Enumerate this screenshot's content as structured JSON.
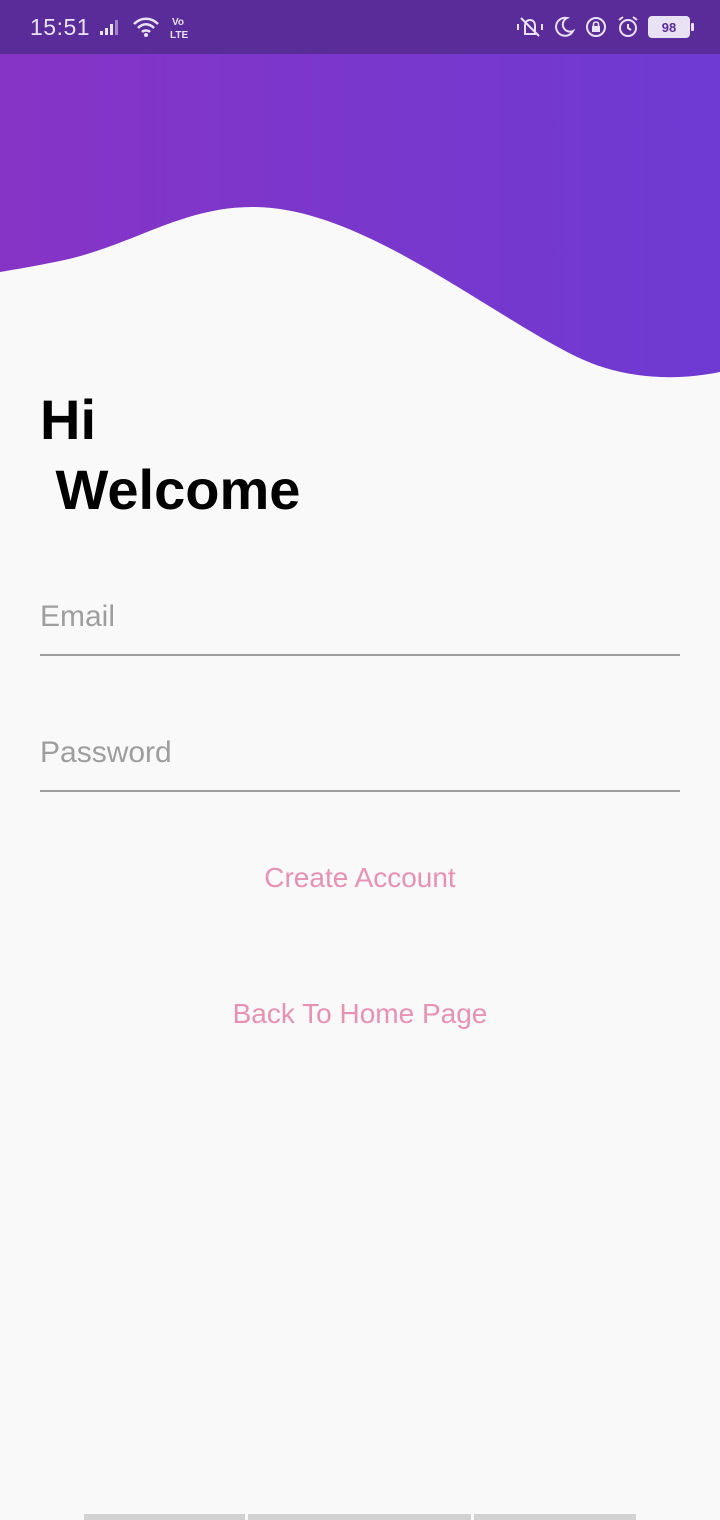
{
  "status_bar": {
    "time": "15:51",
    "network": "Vo LTE",
    "battery": "98",
    "icons": [
      "signal-icon",
      "wifi-icon",
      "vibrate-icon",
      "moon-icon",
      "lock-rotation-icon",
      "alarm-icon",
      "battery-icon"
    ]
  },
  "greeting": {
    "text": "Hi\n Welcome"
  },
  "form": {
    "email_placeholder": "Email",
    "email_value": "",
    "password_placeholder": "Password",
    "password_value": ""
  },
  "actions": {
    "create_account": "Create Account",
    "back_home": "Back To Home Page"
  },
  "colors": {
    "header_purple_left": "#8634c6",
    "header_purple_right": "#6e3ad2",
    "status_bar": "#5a2c9a",
    "link_pink": "#e891b3",
    "background": "#f9f9fa",
    "underline": "#9e9e9e"
  }
}
